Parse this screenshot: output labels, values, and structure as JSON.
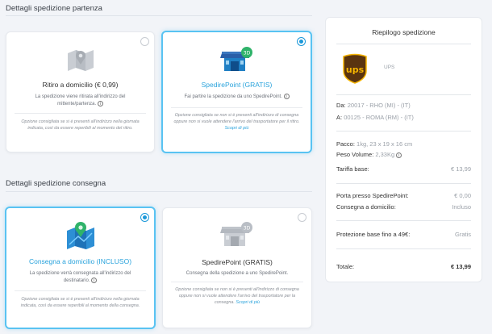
{
  "departure": {
    "title": "Dettagli spedizione partenza",
    "options": [
      {
        "title": "Ritiro a domicilio (€ 0,99)",
        "desc": "La spedizione viene ritirata all'indirizzo del mittente/partenza.",
        "note": "Opzione consigliata se si è presenti all'indirizzo nella giornata indicata, così da essere reperibili al momento del ritiro.",
        "selected": false
      },
      {
        "title": "SpedirePoint (GRATIS)",
        "desc": "Fai partire la spedizione da uno SpedirePoint.",
        "note": "Opzione consigliata se non si è presenti all'indirizzo di consegna oppure non si vuole attendere l'arrivo del trasportatore per il ritiro.",
        "link": "Scopri di più",
        "selected": true
      }
    ]
  },
  "delivery": {
    "title": "Dettagli spedizione consegna",
    "options": [
      {
        "title": "Consegna a domicilio (INCLUSO)",
        "desc": "La spedizione verrà consegnata all'indirizzo del destinatario.",
        "note": "Opzione consigliata se si è presenti all'indirizzo nella giornata indicata, così da essere reperibili al momento della consegna.",
        "selected": true
      },
      {
        "title": "SpedirePoint (GRATIS)",
        "desc": "Consegna della spedizione a uno SpedirePoint.",
        "note": "Opzione consigliata se non si è presenti all'indirizzo di consegna oppure non si vuole attendere l'arrivo del trasportatore per la consegna.",
        "link": "Scopri di più",
        "selected": false
      }
    ]
  },
  "summary": {
    "title": "Riepilogo spedizione",
    "carrier": "UPS",
    "logo_text": "ups",
    "from_label": "Da:",
    "from_value": "20017 - RHO (MI) - (IT)",
    "to_label": "A:",
    "to_value": "00125 - ROMA (RM) - (IT)",
    "package_label": "Pacco:",
    "package_value": "1kg, 23 x 19 x 16 cm",
    "volume_label": "Peso Volume:",
    "volume_value": "2,33Kg",
    "base_label": "Tariffa base:",
    "base_value": "€ 13,99",
    "point_label": "Porta presso SpedirePoint:",
    "point_value": "€ 0,00",
    "home_label": "Consegna a domicilio:",
    "home_value": "Incluso",
    "protection_label": "Protezione base fino a 49€:",
    "protection_value": "Gratis",
    "total_label": "Totale:",
    "total_value": "€ 13,99"
  },
  "colors": {
    "accent": "#2aa3dc",
    "brand_brown": "#5a3410",
    "brand_gold": "#f5b400"
  }
}
